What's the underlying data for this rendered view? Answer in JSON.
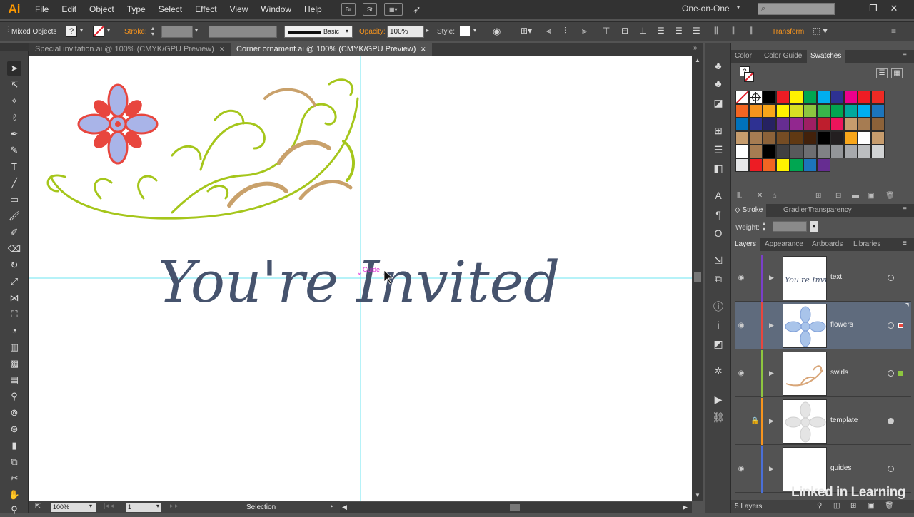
{
  "app": {
    "logo": "Ai"
  },
  "menu": [
    "File",
    "Edit",
    "Object",
    "Type",
    "Select",
    "Effect",
    "View",
    "Window",
    "Help"
  ],
  "menubar_buttons": [
    "Br",
    "St"
  ],
  "workspace": "One-on-One",
  "window_controls": [
    "–",
    "❐",
    "✕"
  ],
  "control_bar": {
    "selection_type": "Mixed Objects",
    "stroke_label": "Stroke:",
    "brush_label": "Basic",
    "opacity_label": "Opacity:",
    "opacity_value": "100%",
    "style_label": "Style:",
    "transform_label": "Transform"
  },
  "tabs": [
    {
      "label": "Special invitation.ai @ 100% (CMYK/GPU Preview)",
      "close": "✕",
      "active": false
    },
    {
      "label": "Corner ornament.ai @ 100% (CMYK/GPU Preview)",
      "close": "✕",
      "active": true
    }
  ],
  "canvas": {
    "headline": "You're Invited",
    "guide_label": "Guide"
  },
  "status": {
    "zoom": "100%",
    "artboard": "1",
    "mode": "Selection"
  },
  "panels": {
    "top_tabs": [
      "Color",
      "Color Guide",
      "Swatches"
    ],
    "mid_tabs": [
      "Stroke",
      "Gradient",
      "Transparency"
    ],
    "weight_label": "Weight:",
    "layer_tabs": [
      "Layers",
      "Appearance",
      "Artboards",
      "Libraries"
    ],
    "layers_count": "5 Layers"
  },
  "swatches": [
    "#ffffff",
    "#ffffff",
    "#000000",
    "#ed1c24",
    "#fff200",
    "#00a651",
    "#00aeef",
    "#2e3192",
    "#ec008c",
    "#ed1c24",
    "#ee2a24",
    "#f26522",
    "#f7941d",
    "#f9a61a",
    "#fff200",
    "#d7df23",
    "#8dc63f",
    "#39b54a",
    "#00a651",
    "#00a99d",
    "#00aeef",
    "#1c75bc",
    "#0072bc",
    "#2e3192",
    "#262262",
    "#662d91",
    "#92278f",
    "#9e1f63",
    "#be1e2d",
    "#ed145b",
    "#c69c6d",
    "#a67c52",
    "#8c6239",
    "#c69c6d",
    "#a67c52",
    "#8c6239",
    "#754c24",
    "#603913",
    "#42210b",
    "#000000",
    "#231f20",
    "#f9a61a",
    "#ffffff",
    "#c69c6d",
    "#ffffff",
    "#a67c52",
    "#000000",
    "#414042",
    "#58595b",
    "#6d6e71",
    "#808285",
    "#939598",
    "#a7a9ac",
    "#bcbec0",
    "#d1d3d4",
    "#e6e7e8",
    "#ed1c24",
    "#f26522",
    "#fff200",
    "#00a651",
    "#1c75bc",
    "#662d91"
  ],
  "layers": [
    {
      "name": "text",
      "color": "#7a3fc9",
      "visible": true,
      "locked": false,
      "selected": false
    },
    {
      "name": "flowers",
      "color": "#e8463e",
      "visible": true,
      "locked": false,
      "selected": true
    },
    {
      "name": "swirls",
      "color": "#8dc63f",
      "visible": true,
      "locked": false,
      "selected": false
    },
    {
      "name": "template",
      "color": "#f7941d",
      "visible": false,
      "locked": true,
      "selected": false
    },
    {
      "name": "guides",
      "color": "#4a6fd8",
      "visible": true,
      "locked": false,
      "selected": false
    }
  ],
  "watermark": "Linked in Learning"
}
